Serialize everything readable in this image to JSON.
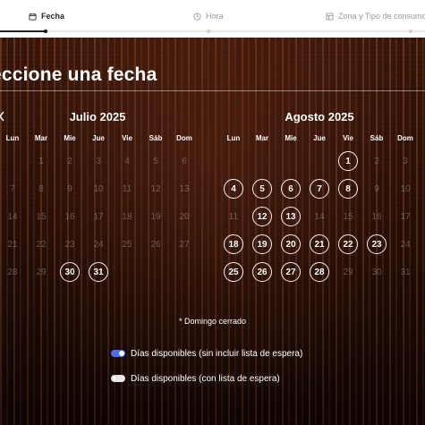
{
  "steps": [
    {
      "label": "Fecha",
      "icon": "calendar-icon",
      "active": true
    },
    {
      "label": "Hora",
      "icon": "clock-icon",
      "active": false
    },
    {
      "label": "Zona y Tipo de consumo",
      "icon": "table-icon",
      "active": false
    }
  ],
  "title": "eccione una fecha",
  "months": [
    {
      "name": "Julio 2025",
      "weekdays": [
        "Lun",
        "Mar",
        "Mie",
        "Jue",
        "Vie",
        "Sáb",
        "Dom"
      ],
      "days": [
        [
          "1",
          "2",
          "3",
          "4",
          "5",
          "6"
        ],
        [
          "7",
          "8",
          "9",
          "10",
          "11",
          "12",
          "13"
        ],
        [
          "14",
          "15",
          "16",
          "17",
          "18",
          "19",
          "20"
        ],
        [
          "21",
          "22",
          "23",
          "24",
          "25",
          "26",
          "27"
        ],
        [
          "28",
          "29",
          "30",
          "31"
        ]
      ],
      "available": [
        "30",
        "31"
      ]
    },
    {
      "name": "Agosto 2025",
      "weekdays": [
        "Lun",
        "Mar",
        "Mie",
        "Jue",
        "Vie",
        "Sáb",
        "Dom"
      ],
      "days": [
        [
          "1",
          "2",
          "3"
        ],
        [
          "4",
          "5",
          "6",
          "7",
          "8",
          "9",
          "10"
        ],
        [
          "11",
          "12",
          "13",
          "14",
          "15",
          "16",
          "17"
        ],
        [
          "18",
          "19",
          "20",
          "21",
          "22",
          "23",
          "24"
        ],
        [
          "25",
          "26",
          "27",
          "28",
          "29",
          "30",
          "31"
        ]
      ],
      "available": [
        "1",
        "4",
        "5",
        "6",
        "7",
        "8",
        "12",
        "13",
        "18",
        "19",
        "20",
        "21",
        "22",
        "23",
        "25",
        "26",
        "27",
        "28"
      ]
    }
  ],
  "note": "* Domingo cerrado",
  "legend": [
    {
      "label": "Días disponibles (sin incluir lista de espera)",
      "state": "on",
      "color": "#4a6cf0"
    },
    {
      "label": "Días disponibles (con lista de espera)",
      "state": "off",
      "color": "#e9e9e9"
    }
  ]
}
